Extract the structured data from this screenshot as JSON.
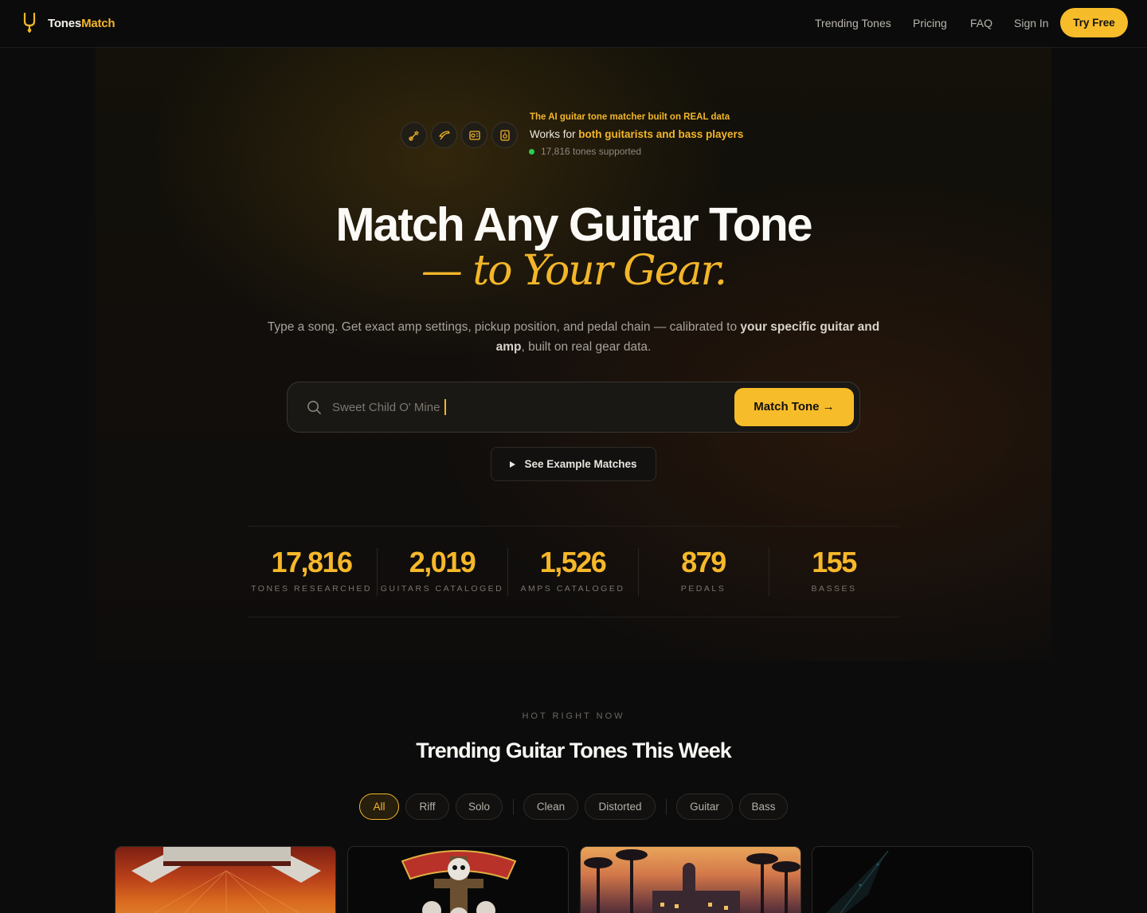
{
  "nav": {
    "brand_a": "Tones",
    "brand_b": "Match",
    "links": [
      "Trending Tones",
      "Pricing",
      "FAQ",
      "Sign In"
    ],
    "cta": "Try Free"
  },
  "badge": {
    "icons": [
      "guitar-icon",
      "bass-icon",
      "amp-icon",
      "speaker-icon"
    ],
    "tagline": "The AI guitar tone matcher built on REAL data",
    "works_prefix": "Works for ",
    "works_bold": "both guitarists and bass players",
    "supported": "17,816 tones supported"
  },
  "hero": {
    "title": "Match Any Guitar Tone",
    "subtitle": "— to Your Gear.",
    "desc_a": "Type a song. Get exact amp settings, pickup position, and pedal chain — calibrated to ",
    "desc_bold": "your specific guitar and amp",
    "desc_b": ", built on real gear data."
  },
  "search": {
    "value": "Sweet Child O' Mine",
    "button": "Match Tone →"
  },
  "examples_button": "See Example Matches",
  "stats": [
    {
      "value": "17,816",
      "label": "TONES RESEARCHED"
    },
    {
      "value": "2,019",
      "label": "GUITARS CATALOGED"
    },
    {
      "value": "1,526",
      "label": "AMPS CATALOGED"
    },
    {
      "value": "879",
      "label": "PEDALS"
    },
    {
      "value": "155",
      "label": "BASSES"
    }
  ],
  "trending": {
    "eyebrow": "HOT RIGHT NOW",
    "title": "Trending Guitar Tones This Week",
    "filters": [
      "All",
      "Riff",
      "Solo",
      "Clean",
      "Distorted",
      "Guitar",
      "Bass"
    ],
    "active_filter": "All"
  },
  "colors": {
    "accent": "#f3b629",
    "background": "#0c0c0c",
    "status_green": "#2ecc4f"
  }
}
